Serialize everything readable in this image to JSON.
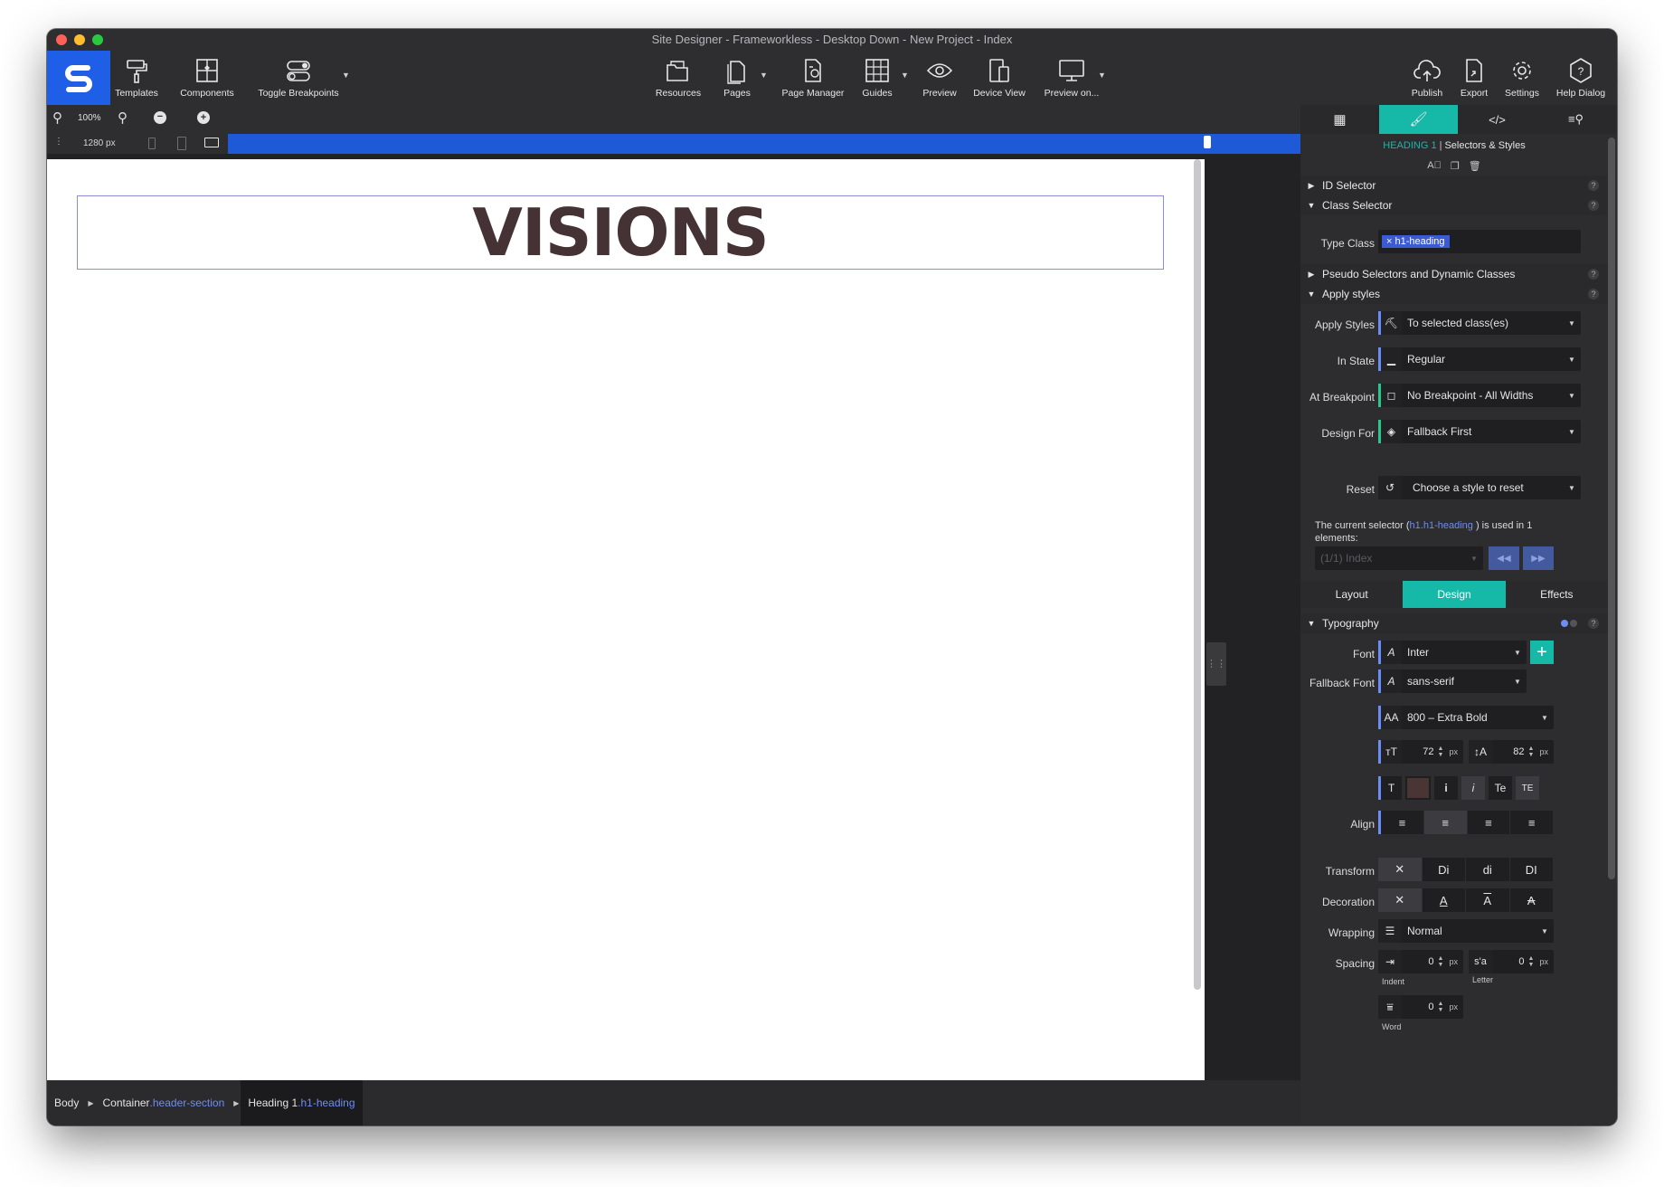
{
  "window": {
    "title": "Site Designer - Frameworkless - Desktop Down - New Project - Index"
  },
  "toolbar": {
    "left": [
      {
        "id": "templates",
        "label": "Templates",
        "icon": "paint-roller-icon"
      },
      {
        "id": "components",
        "label": "Components",
        "icon": "components-icon"
      },
      {
        "id": "toggle-breakpoints",
        "label": "Toggle Breakpoints",
        "icon": "toggle-icon"
      }
    ],
    "center": [
      {
        "id": "resources",
        "label": "Resources",
        "icon": "folder-icon"
      },
      {
        "id": "pages",
        "label": "Pages",
        "icon": "pages-icon"
      },
      {
        "id": "page-manager",
        "label": "Page Manager",
        "icon": "page-manager-icon"
      },
      {
        "id": "guides",
        "label": "Guides",
        "icon": "grid-icon"
      },
      {
        "id": "preview",
        "label": "Preview",
        "icon": "eye-icon"
      },
      {
        "id": "device-view",
        "label": "Device View",
        "icon": "devices-icon"
      },
      {
        "id": "preview-on",
        "label": "Preview on...",
        "icon": "monitor-icon"
      }
    ],
    "right": [
      {
        "id": "publish",
        "label": "Publish",
        "icon": "cloud-upload-icon"
      },
      {
        "id": "export",
        "label": "Export",
        "icon": "export-icon"
      },
      {
        "id": "settings",
        "label": "Settings",
        "icon": "gear-icon"
      },
      {
        "id": "help",
        "label": "Help Dialog",
        "icon": "help-icon"
      }
    ]
  },
  "zoom": {
    "level": "100%",
    "width_readout": "1280 px"
  },
  "canvas": {
    "heading": "VISIONS"
  },
  "breadcrumb": [
    {
      "name": "Body",
      "class": ""
    },
    {
      "name": "Container",
      "class": ".header-section"
    },
    {
      "name": "Heading 1",
      "class": ".h1-heading"
    }
  ],
  "panel": {
    "header_element": "HEADING 1",
    "header_title": "Selectors & Styles",
    "sections": {
      "id_selector": "ID Selector",
      "class_selector": "Class Selector",
      "pseudo": "Pseudo Selectors and Dynamic Classes",
      "apply_styles": "Apply styles",
      "typography": "Typography"
    },
    "type_class_label": "Type Class",
    "type_class_chip": "h1-heading",
    "apply": {
      "apply_styles_label": "Apply Styles",
      "apply_styles_value": "To selected class(es)",
      "in_state_label": "In State",
      "in_state_value": "Regular",
      "at_breakpoint_label": "At Breakpoint",
      "at_breakpoint_value": "No Breakpoint - All Widths",
      "design_for_label": "Design For",
      "design_for_value": "Fallback First",
      "reset_label": "Reset",
      "reset_value": "Choose a style to reset"
    },
    "usage_text_1": "The current selector (",
    "usage_selector": "h1.h1-heading",
    "usage_text_2": ") is used in",
    "usage_count": "1",
    "usage_text_3": "elements:",
    "usage_dropdown": "(1/1) Index",
    "tabs": {
      "layout": "Layout",
      "design": "Design",
      "effects": "Effects"
    },
    "typography": {
      "font_label": "Font",
      "font_value": "Inter",
      "fallback_label": "Fallback Font",
      "fallback_value": "sans-serif",
      "weight_value": "800 – Extra Bold",
      "size_value": "72",
      "size_unit": "px",
      "line_height_value": "82",
      "line_height_unit": "px",
      "align_label": "Align",
      "transform_label": "Transform",
      "transform_options": [
        "Di",
        "di",
        "DI"
      ],
      "decoration_label": "Decoration",
      "wrapping_label": "Wrapping",
      "wrapping_value": "Normal",
      "spacing_label": "Spacing",
      "indent_value": "0",
      "indent_unit": "px",
      "indent_caption": "Indent",
      "letter_value": "0",
      "letter_unit": "px",
      "letter_caption": "Letter",
      "word_value": "0",
      "word_unit": "px",
      "word_caption": "Word",
      "color_swatch": "#4a3535"
    }
  },
  "colors": {
    "brand_blue": "#1f5ee6",
    "accent_teal": "#16b8a8",
    "link_blue": "#6d8df5",
    "heading_color": "#453234"
  }
}
